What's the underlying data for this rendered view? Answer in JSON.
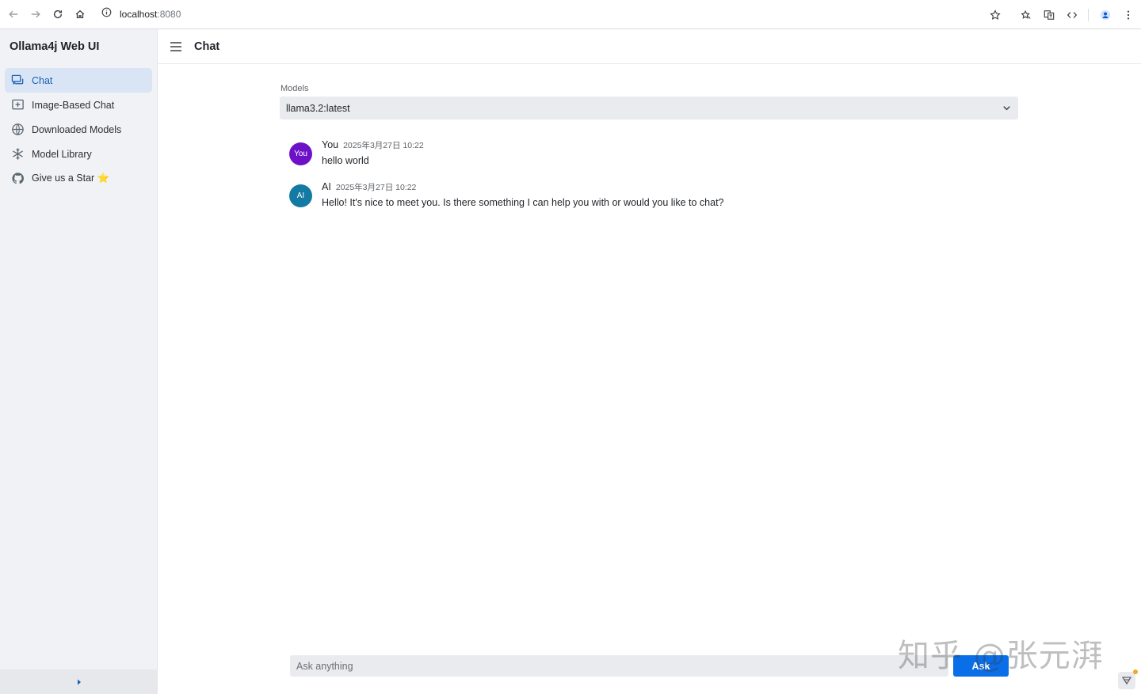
{
  "browser": {
    "url_host": "localhost",
    "url_port": ":8080"
  },
  "sidebar": {
    "title": "Ollama4j Web UI",
    "items": [
      {
        "label": "Chat",
        "icon": "chat-icon",
        "active": true
      },
      {
        "label": "Image-Based Chat",
        "icon": "image-chat-icon",
        "active": false
      },
      {
        "label": "Downloaded Models",
        "icon": "globe-icon",
        "active": false
      },
      {
        "label": "Model Library",
        "icon": "snowflake-icon",
        "active": false
      },
      {
        "label": "Give us a Star ⭐",
        "icon": "github-icon",
        "active": false
      }
    ]
  },
  "header": {
    "title": "Chat"
  },
  "models": {
    "label": "Models",
    "selected": "llama3.2:latest"
  },
  "messages": [
    {
      "avatar": "You",
      "author": "You",
      "time": "2025年3月27日 10:22",
      "text": "hello world",
      "color": "#6d11c9"
    },
    {
      "avatar": "AI",
      "author": "AI",
      "time": "2025年3月27日 10:22",
      "text": "Hello! It's nice to meet you. Is there something I can help you with or would you like to chat?",
      "color": "#127aa3"
    }
  ],
  "composer": {
    "placeholder": "Ask anything",
    "button": "Ask"
  },
  "watermark": "知乎 @张元湃",
  "colors": {
    "accent": "#0a6ee8",
    "active_nav_bg": "#d9e5f5",
    "active_nav_text": "#1a5fb4"
  }
}
